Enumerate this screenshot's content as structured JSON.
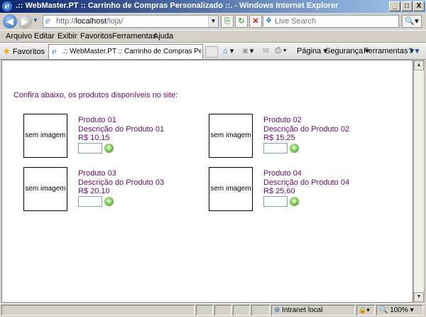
{
  "window": {
    "title": ".:: WebMaster.PT :: Carrinho de Compras Personalizado ::. - Windows Internet Explorer",
    "minimize_label": "_",
    "maximize_label": "□",
    "close_label": "X"
  },
  "address_bar": {
    "url_prefix": "http://",
    "url_host": "localhost",
    "url_path": "/loja/",
    "dropdown_icon": "▼"
  },
  "search": {
    "placeholder": "Live Search",
    "button_icon": "🔍▾"
  },
  "menu": {
    "items": [
      "Arquivo",
      "Editar",
      "Exibir",
      "Favoritos",
      "Ferramentas",
      "Ajuda"
    ]
  },
  "toolbar": {
    "favorites_label": "Favoritos",
    "tab_title": ".:: WebMaster.PT :: Carrinho de Compras Personaliz...",
    "page_label": "Página ▾",
    "security_label": "Segurança ▾",
    "tools_label": "Ferramentas ▾",
    "help_icon": "? ▾"
  },
  "page": {
    "intro": "Confira abaixo, os produtos disponíveis no site:",
    "image_placeholder": "sem imagem",
    "add_icon": "+",
    "products": [
      {
        "name": "Produto 01",
        "description": "Descrição do Produto 01",
        "price": "R$ 10,15"
      },
      {
        "name": "Produto 02",
        "description": "Descrição do Produto 02",
        "price": "R$ 15,25"
      },
      {
        "name": "Produto 03",
        "description": "Descrição do Produto 03",
        "price": "R$ 20,10"
      },
      {
        "name": "Produto 04",
        "description": "Descrição do Produto 04",
        "price": "R$ 25,60"
      }
    ]
  },
  "status": {
    "zone": "Intranet local",
    "zoom": "100%"
  },
  "colors": {
    "link_text": "#6b0a6b",
    "add_button": "#3aa21a"
  }
}
